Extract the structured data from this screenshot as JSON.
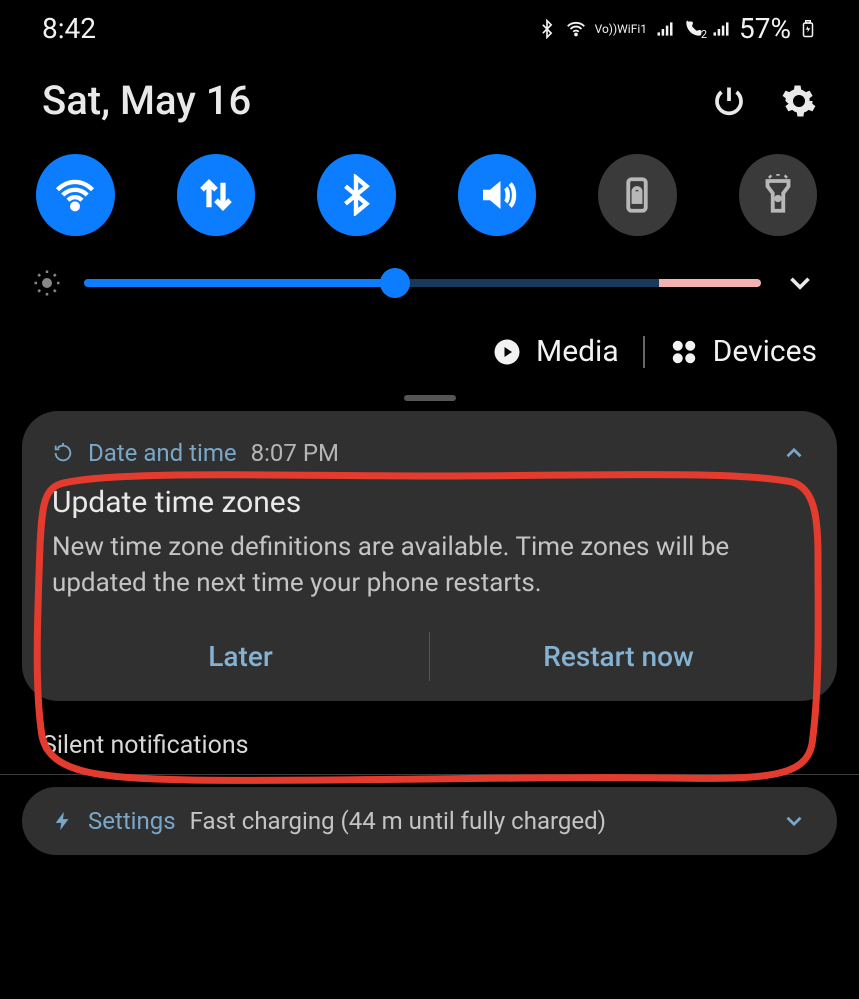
{
  "status": {
    "time": "8:42",
    "wifi_label": "WiFi1",
    "vo_label": "Vo))",
    "call_badge": "2",
    "battery_percent": "57%"
  },
  "header": {
    "date": "Sat, May 16"
  },
  "toggles": {
    "wifi": {
      "name": "wifi",
      "on": true
    },
    "data": {
      "name": "mobile-data",
      "on": true
    },
    "bluetooth": {
      "name": "bluetooth",
      "on": true
    },
    "sound": {
      "name": "sound",
      "on": true
    },
    "rotation": {
      "name": "auto-rotate",
      "on": false
    },
    "flashlight": {
      "name": "flashlight",
      "on": false
    }
  },
  "brightness": {
    "value_pct": 46,
    "auto_limit_pct": 85
  },
  "shortcuts": {
    "media": "Media",
    "devices": "Devices"
  },
  "notification": {
    "app": "Date and time",
    "timestamp": "8:07 PM",
    "title": "Update time zones",
    "body": "New time zone definitions are available. Time zones will be updated the next time your phone restarts.",
    "action_later": "Later",
    "action_restart": "Restart now"
  },
  "silent": {
    "header": "Silent notifications",
    "app": "Settings",
    "message": "Fast charging (44 m until fully charged)"
  }
}
